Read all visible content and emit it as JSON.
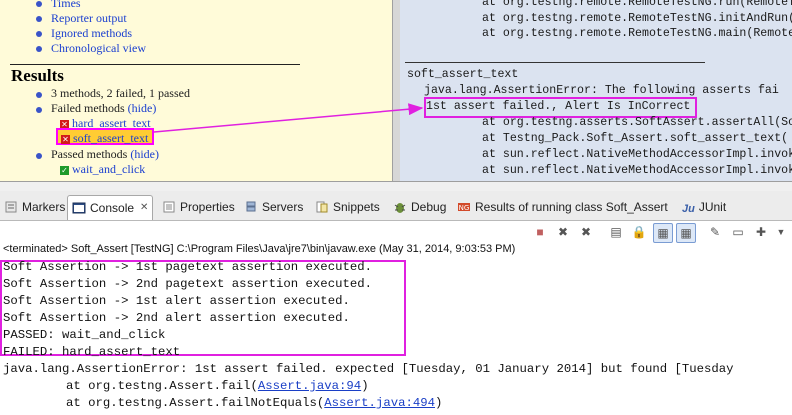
{
  "left_report": {
    "top_links": [
      "Times",
      "Reporter output",
      "Ignored methods",
      "Chronological view"
    ],
    "results_title": "Results",
    "summary": "3 methods, 2 failed, 1 passed",
    "failed_label": "Failed methods",
    "failed_toggle": "(hide)",
    "failed_methods": [
      "hard_assert_text",
      "soft_assert_text"
    ],
    "passed_label": "Passed methods",
    "passed_toggle": "(hide)",
    "passed_methods": [
      "wait_and_click"
    ]
  },
  "right_report": {
    "lines_top": [
      "at org.testng.remote.RemoteTestNG.run(RemoteTestNG",
      "at org.testng.remote.RemoteTestNG.initAndRun(Rem",
      "at org.testng.remote.RemoteTestNG.main(RemoteTestNG"
    ],
    "method_name": "soft_assert_text",
    "error_line": "java.lang.AssertionError: The following asserts fai",
    "highlight_line": "1st assert failed., Alert Is InCorrect",
    "lines_bottom": [
      "at org.testng.asserts.SoftAssert.assertAll(So",
      "at Testng_Pack.Soft_Assert.soft_assert_text(",
      "at sun.reflect.NativeMethodAccessorImpl.invok",
      "at sun.reflect.NativeMethodAccessorImpl.invok"
    ]
  },
  "tabs": [
    {
      "label": "Markers",
      "icon": "markers-icon"
    },
    {
      "label": "Console",
      "icon": "console-icon",
      "active": true
    },
    {
      "label": "Properties",
      "icon": "properties-icon"
    },
    {
      "label": "Servers",
      "icon": "servers-icon"
    },
    {
      "label": "Snippets",
      "icon": "snippets-icon"
    },
    {
      "label": "Debug",
      "icon": "debug-icon"
    },
    {
      "label": "Results of running class Soft_Assert",
      "icon": "testng-results-icon"
    },
    {
      "label": "JUnit",
      "icon": "junit-icon"
    }
  ],
  "console": {
    "terminated": "<terminated> Soft_Assert [TestNG] C:\\Program Files\\Java\\jre7\\bin\\javaw.exe (May 31, 2014, 9:03:53 PM)",
    "boxed_lines": [
      "Soft Assertion -> 1st pagetext assertion executed.",
      "Soft Assertion -> 2nd pagetext assertion executed.",
      "Soft Assertion -> 1st alert assertion executed.",
      "Soft Assertion -> 2nd alert assertion executed.",
      "PASSED: wait_and_click",
      "FAILED: hard_assert_text"
    ],
    "error_line": "java.lang.AssertionError: 1st assert failed. expected [Tuesday, 01 January 2014] but found [Tuesday",
    "stack": [
      {
        "prefix": "at org.testng.Assert.fail(",
        "link": "Assert.java:94",
        "suffix": ")"
      },
      {
        "prefix": "at org.testng.Assert.failNotEquals(",
        "link": "Assert.java:494",
        "suffix": ")"
      }
    ]
  },
  "colors": {
    "highlight_magenta": "#e020e0",
    "report_bg": "#fffbd9",
    "detail_bg": "#dbe3f0",
    "link_blue": "#1b3fd0"
  }
}
